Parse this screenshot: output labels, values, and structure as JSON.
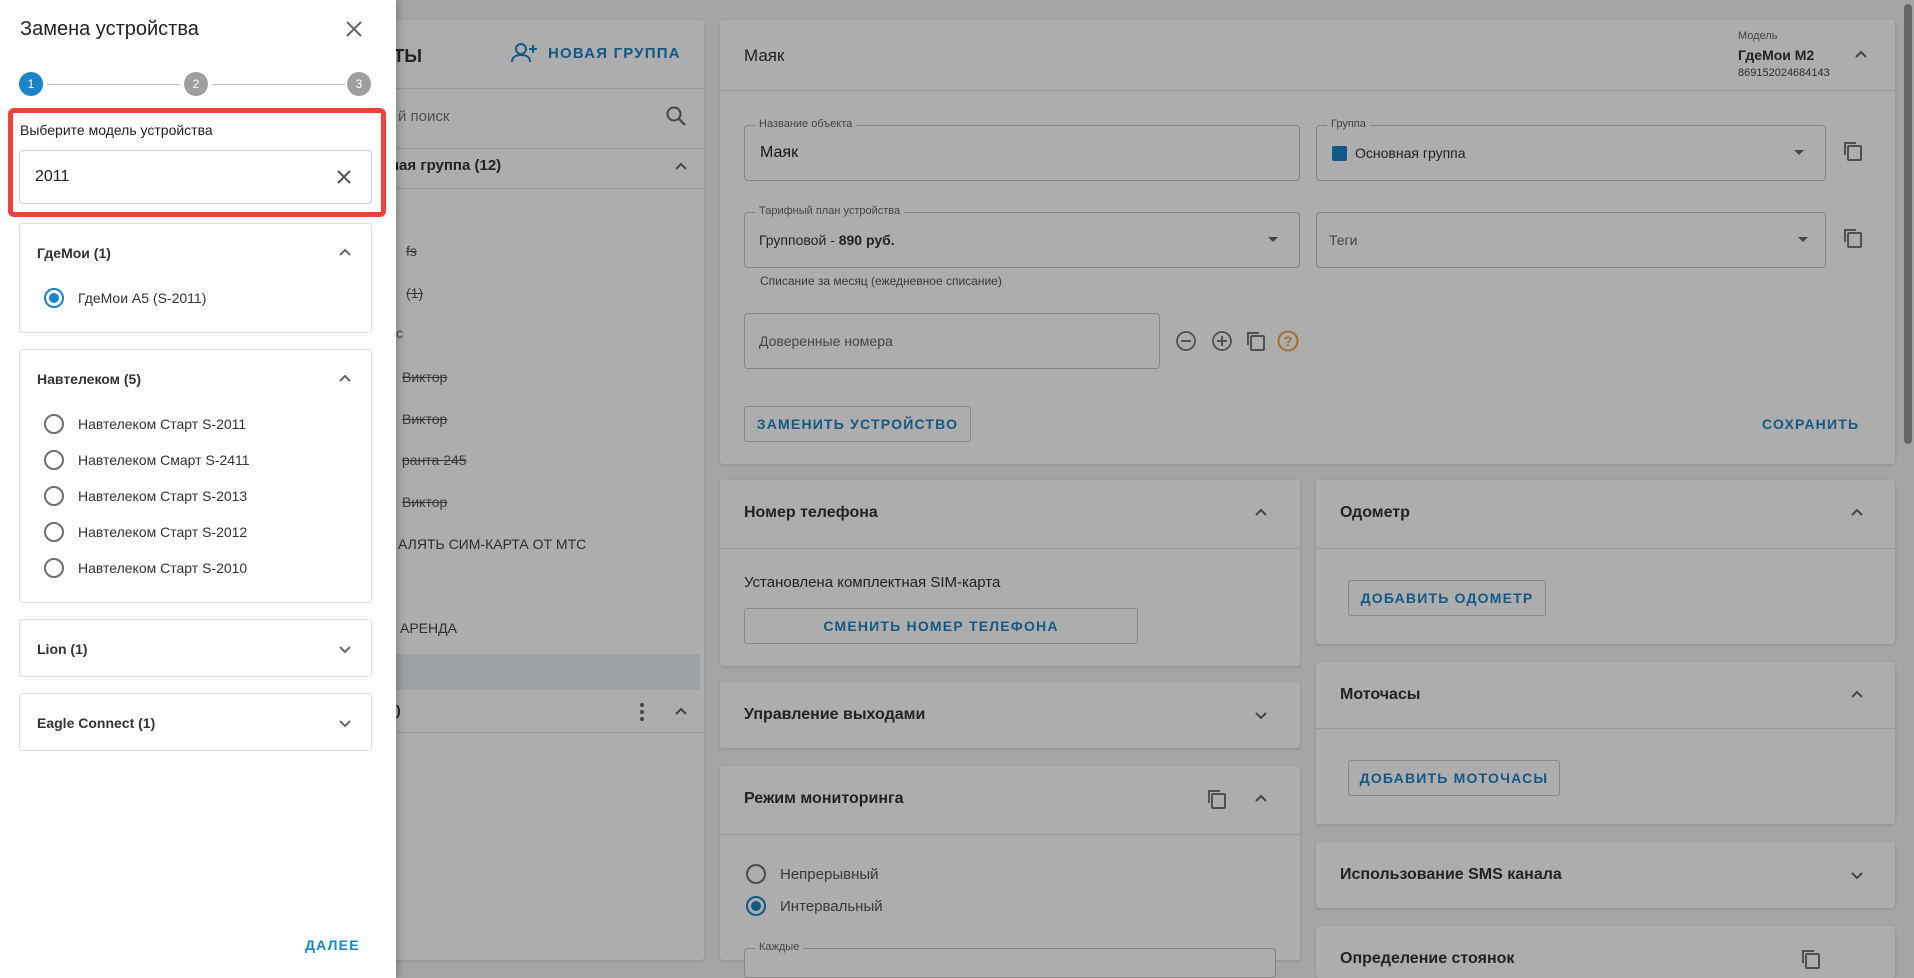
{
  "objects_panel": {
    "title_partial": "КТЫ",
    "new_group_label": "НОВАЯ ГРУППА",
    "search_placeholder": "й поиск",
    "group_label": "ная группа  (12)",
    "items": [
      "fs",
      "(1)",
      "с",
      "Виктор",
      "Виктор",
      "ранта 245",
      "Виктор",
      "АЛЯТЬ СИМ-КАРТА ОТ МТС",
      "АРЕНДА"
    ],
    "bottom_group": ")"
  },
  "object_card": {
    "title": "Маяк",
    "model_caption": "Модель",
    "model_name": "ГдеМои М2",
    "model_imei": "869152024684143",
    "name_label": "Название объекта",
    "name_value": "Маяк",
    "group_label": "Группа",
    "group_value": "Основная группа",
    "group_color": "#1a84c6",
    "tariff_label": "Тарифный план устройства",
    "tariff_prefix": "Групповой - ",
    "tariff_price": "890 руб.",
    "tariff_hint": "Списание за месяц (ежедневное списание)",
    "tags_placeholder": "Теги",
    "trusted_placeholder": "Доверенные номера",
    "replace_button": "ЗАМЕНИТЬ УСТРОЙСТВО",
    "save_button": "СОХРАНИТЬ"
  },
  "phone_card": {
    "title": "Номер телефона",
    "status": "Установлена комплектная SIM-карта",
    "change_button": "СМЕНИТЬ НОМЕР ТЕЛЕФОНА"
  },
  "outputs_card": {
    "title": "Управление выходами"
  },
  "monitoring_card": {
    "title": "Режим мониторинга",
    "options": [
      {
        "label": "Непрерывный",
        "selected": false
      },
      {
        "label": "Интервальный",
        "selected": true
      }
    ],
    "every_label": "Каждые"
  },
  "odometer_card": {
    "title": "Одометр",
    "add_button": "ДОБАВИТЬ ОДОМЕТР"
  },
  "motohours_card": {
    "title": "Моточасы",
    "add_button": "ДОБАВИТЬ МОТОЧАСЫ"
  },
  "sms_card": {
    "title": "Использование SMS канала"
  },
  "parking_card": {
    "title": "Определение стоянок"
  },
  "drawer": {
    "title": "Замена устройства",
    "steps": [
      "1",
      "2",
      "3"
    ],
    "active_step": 1,
    "model_select_label": "Выберите модель устройства",
    "search_value": "2011",
    "groups": [
      {
        "name": "ГдеМои (1)",
        "expanded": true,
        "items": [
          {
            "label": "ГдеМои А5 (S-2011)",
            "selected": true
          }
        ]
      },
      {
        "name": "Навтелеком (5)",
        "expanded": true,
        "items": [
          {
            "label": "Навтелеком Старт S-2011",
            "selected": false
          },
          {
            "label": "Навтелеком Смарт S-2411",
            "selected": false
          },
          {
            "label": "Навтелеком Старт S-2013",
            "selected": false
          },
          {
            "label": "Навтелеком Старт S-2012",
            "selected": false
          },
          {
            "label": "Навтелеком Старт S-2010",
            "selected": false
          }
        ]
      },
      {
        "name": "Lion (1)",
        "expanded": false,
        "items": []
      },
      {
        "name": "Eagle Connect (1)",
        "expanded": false,
        "items": []
      }
    ],
    "next_button": "ДАЛЕЕ",
    "accent": "#1a84c6",
    "highlight_color": "#f0423a"
  }
}
